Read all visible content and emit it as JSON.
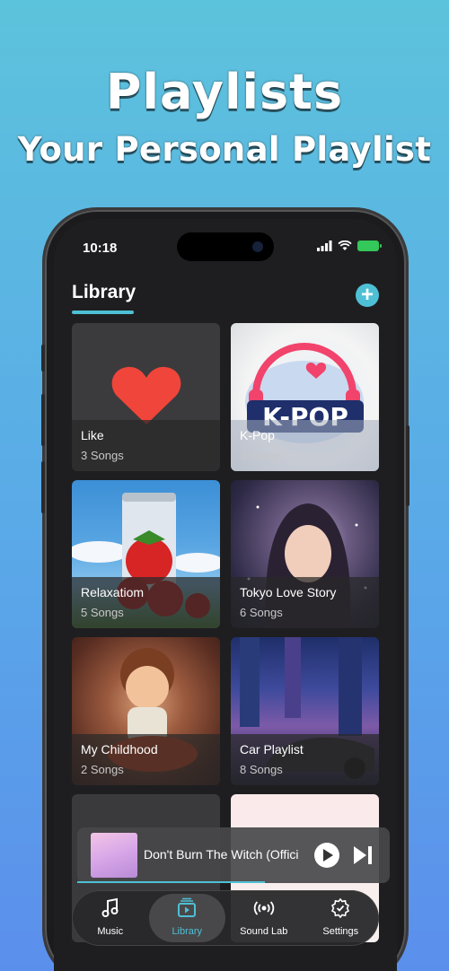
{
  "headline": {
    "title": "Playlists",
    "subtitle": "Your Personal Playlist"
  },
  "status_bar": {
    "time": "10:18"
  },
  "library": {
    "title": "Library",
    "add_icon": "plus-circle-icon",
    "playlists": [
      {
        "name": "Like",
        "count": "3 Songs"
      },
      {
        "name": "K-Pop",
        "count": "3 Songs"
      },
      {
        "name": "Relaxatiom",
        "count": "5 Songs"
      },
      {
        "name": "Tokyo Love Story",
        "count": "6 Songs"
      },
      {
        "name": "My Childhood",
        "count": "2 Songs"
      },
      {
        "name": "Car Playlist",
        "count": "8 Songs"
      },
      {
        "name": "",
        "count": ""
      },
      {
        "name": "",
        "count": ""
      }
    ]
  },
  "mini_player": {
    "title": "Don't Burn The Witch (Offici",
    "progress": 0.6
  },
  "tab_bar": {
    "tabs": [
      {
        "label": "Music",
        "icon": "music-note-icon"
      },
      {
        "label": "Library",
        "icon": "library-play-icon",
        "active": true
      },
      {
        "label": "Sound Lab",
        "icon": "broadcast-icon"
      },
      {
        "label": "Settings",
        "icon": "gear-icon"
      }
    ]
  },
  "colors": {
    "accent": "#4ec0d5",
    "heart": "#f0453a",
    "battery": "#34c759"
  }
}
